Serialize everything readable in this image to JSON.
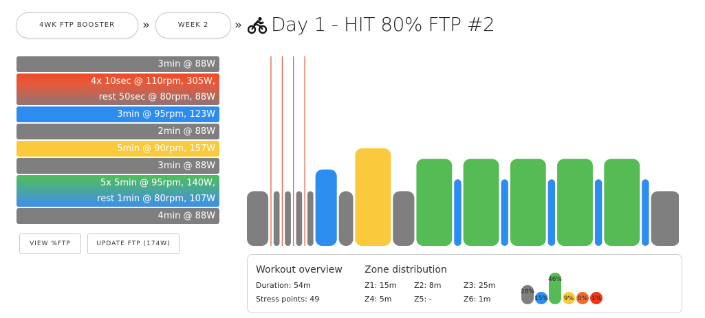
{
  "breadcrumb": {
    "program": "4WK FTP BOOSTER",
    "week": "WEEK 2",
    "separator": "»"
  },
  "workout": {
    "title": "Day 1 - HIT 80% FTP #2",
    "type_icon": "cyclist-icon"
  },
  "steps": [
    {
      "lines": [
        "3min @ 88W"
      ],
      "style": "gray"
    },
    {
      "lines": [
        "4x 10sec @ 110rpm, 305W,",
        "rest 50sec @ 80rpm, 88W"
      ],
      "style": "grad-red"
    },
    {
      "lines": [
        "3min @ 95rpm, 123W"
      ],
      "style": "blue"
    },
    {
      "lines": [
        "2min @ 88W"
      ],
      "style": "gray"
    },
    {
      "lines": [
        "5min @ 90rpm, 157W"
      ],
      "style": "yellow"
    },
    {
      "lines": [
        "3min @ 88W"
      ],
      "style": "gray"
    },
    {
      "lines": [
        "5x 5min @ 95rpm, 140W,",
        "rest 1min @ 80rpm, 107W"
      ],
      "style": "grad-green"
    },
    {
      "lines": [
        "4min @ 88W"
      ],
      "style": "gray"
    }
  ],
  "buttons": {
    "view_ftp": "VIEW %FTP",
    "update_ftp": "UPDATE FTP (174W)"
  },
  "colors": {
    "z1": "#7f7f7f",
    "z2": "#2d8cf0",
    "z3": "#55bb55",
    "z4": "#fbc93c",
    "z5": "#f26b2c",
    "z6": "#ee3a1c",
    "interval_line": "#e0583a"
  },
  "chart_data": {
    "type": "bar",
    "y_unit": "W",
    "blocks": [
      {
        "duration_min": 3,
        "watts": 88,
        "zone": "z1"
      },
      {
        "duration_min": 0.1667,
        "watts": 305,
        "zone": "z6"
      },
      {
        "duration_min": 0.8333,
        "watts": 88,
        "zone": "z1"
      },
      {
        "duration_min": 0.1667,
        "watts": 305,
        "zone": "z6"
      },
      {
        "duration_min": 0.8333,
        "watts": 88,
        "zone": "z1"
      },
      {
        "duration_min": 0.1667,
        "watts": 305,
        "zone": "z6"
      },
      {
        "duration_min": 0.8333,
        "watts": 88,
        "zone": "z1"
      },
      {
        "duration_min": 0.1667,
        "watts": 305,
        "zone": "z6"
      },
      {
        "duration_min": 0.8333,
        "watts": 88,
        "zone": "z1"
      },
      {
        "duration_min": 3,
        "watts": 123,
        "zone": "z2"
      },
      {
        "duration_min": 2,
        "watts": 88,
        "zone": "z1"
      },
      {
        "duration_min": 5,
        "watts": 157,
        "zone": "z4"
      },
      {
        "duration_min": 3,
        "watts": 88,
        "zone": "z1"
      },
      {
        "duration_min": 5,
        "watts": 140,
        "zone": "z3"
      },
      {
        "duration_min": 1,
        "watts": 107,
        "zone": "z2"
      },
      {
        "duration_min": 5,
        "watts": 140,
        "zone": "z3"
      },
      {
        "duration_min": 1,
        "watts": 107,
        "zone": "z2"
      },
      {
        "duration_min": 5,
        "watts": 140,
        "zone": "z3"
      },
      {
        "duration_min": 1,
        "watts": 107,
        "zone": "z2"
      },
      {
        "duration_min": 5,
        "watts": 140,
        "zone": "z3"
      },
      {
        "duration_min": 1,
        "watts": 107,
        "zone": "z2"
      },
      {
        "duration_min": 5,
        "watts": 140,
        "zone": "z3"
      },
      {
        "duration_min": 1,
        "watts": 107,
        "zone": "z2"
      },
      {
        "duration_min": 4,
        "watts": 88,
        "zone": "z1"
      }
    ]
  },
  "overview": {
    "heading": "Workout overview",
    "duration": "Duration: 54m",
    "stress": "Stress points: 49"
  },
  "zones": {
    "heading": "Zone distribution",
    "items": [
      {
        "label": "Z1: 15m",
        "pct": "28%",
        "value": 28,
        "color": "#7f7f7f"
      },
      {
        "label": "Z2: 8m",
        "pct": "15%",
        "value": 15,
        "color": "#2d8cf0"
      },
      {
        "label": "Z3: 25m",
        "pct": "46%",
        "value": 46,
        "color": "#55bb55"
      },
      {
        "label": "Z4: 5m",
        "pct": "9%",
        "value": 9,
        "color": "#fbc93c"
      },
      {
        "label": "Z5: -",
        "pct": "0%",
        "value": 0,
        "color": "#f26b2c"
      },
      {
        "label": "Z6: 1m",
        "pct": "1%",
        "value": 1,
        "color": "#ee3a1c"
      }
    ]
  }
}
